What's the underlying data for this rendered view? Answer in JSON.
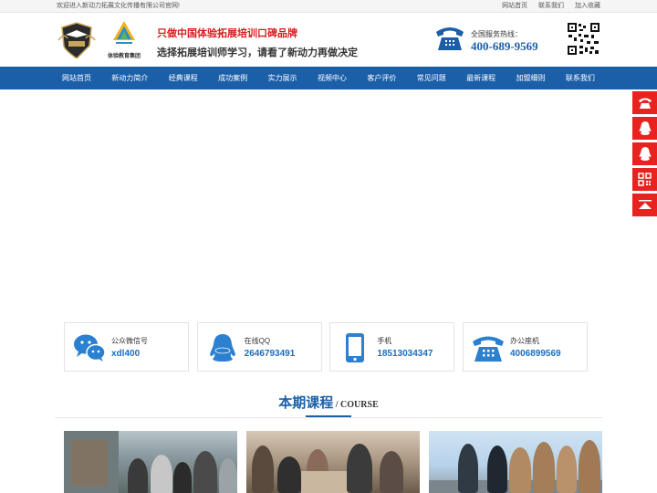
{
  "topbar": {
    "welcome": "欢迎进入新动力拓展文化传播有限公司官网!",
    "links": [
      "网站首页",
      "联系我们",
      "加入收藏"
    ]
  },
  "header": {
    "logo1_icon": "eagle-shield-logo-icon",
    "logo2_caption": "体验教育集团",
    "slogan_line1": "只做中国体验拓展培训口碑品牌",
    "slogan_line2": "选择拓展培训师学习，请看了新动力再做决定",
    "hotline_label": "全国服务热线：",
    "hotline_number": "400-689-9569",
    "qr_icon": "qr-code-icon"
  },
  "nav": {
    "items": [
      "网站首页",
      "新动力简介",
      "经典课程",
      "成功案例",
      "实力展示",
      "视频中心",
      "客户评价",
      "常见问题",
      "最新课程",
      "加盟细则",
      "联系我们"
    ]
  },
  "contacts": [
    {
      "icon": "wechat-icon",
      "label": "公众微信号",
      "value": "xdl400"
    },
    {
      "icon": "qq-icon",
      "label": "在线QQ",
      "value": "2646793491"
    },
    {
      "icon": "mobile-phone-icon",
      "label": "手机",
      "value": "18513034347"
    },
    {
      "icon": "telephone-icon",
      "label": "办公座机",
      "value": "4006899569"
    }
  ],
  "section": {
    "title_cn": "本期课程",
    "title_en": " / COURSE"
  },
  "sidebar": [
    "telephone-icon",
    "qq-icon",
    "qq-icon",
    "qr-code-icon",
    "back-to-top-icon"
  ],
  "colors": {
    "brand_blue": "#1b5fa8",
    "value_blue": "#1b6ec2",
    "slogan_red": "#d61d1d",
    "sidebar_red": "#e8221f"
  }
}
